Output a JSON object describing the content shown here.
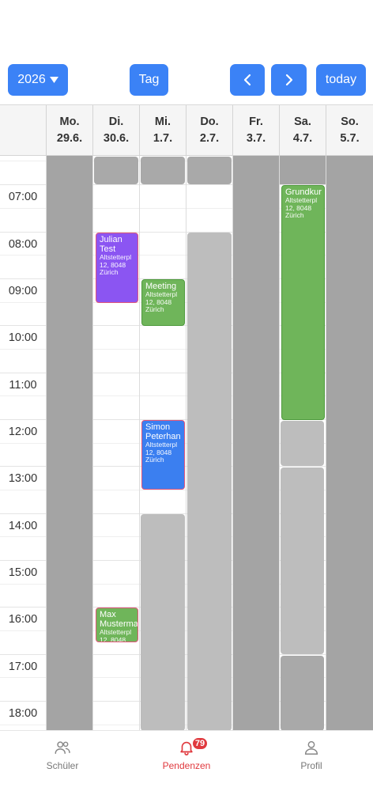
{
  "toolbar": {
    "year_label": "2026",
    "view_label": "Tag",
    "today_label": "today"
  },
  "calendar": {
    "days": [
      {
        "name": "Mo.",
        "date": "29.6."
      },
      {
        "name": "Di.",
        "date": "30.6."
      },
      {
        "name": "Mi.",
        "date": "1.7."
      },
      {
        "name": "Do.",
        "date": "2.7."
      },
      {
        "name": "Fr.",
        "date": "3.7."
      },
      {
        "name": "Sa.",
        "date": "4.7."
      },
      {
        "name": "So.",
        "date": "5.7."
      }
    ],
    "hours": [
      "07:00",
      "08:00",
      "09:00",
      "10:00",
      "11:00",
      "12:00",
      "13:00",
      "14:00",
      "15:00",
      "16:00",
      "17:00",
      "18:00"
    ],
    "events": [
      {
        "title": "Julian\nTest",
        "address": "Altstetterpl\n12, 8048\nZürich"
      },
      {
        "title": "Meeting",
        "address": "Altstetterpl\n12, 8048\nZürich"
      },
      {
        "title": "Simon\nPeterhan",
        "address": "Altstetterpl\n12, 8048\nZürich"
      },
      {
        "title": "Max\nMusterma",
        "address": "Altstetterpl\n12, 8048"
      },
      {
        "title": "Grundkur",
        "address": "Altstetterpl\n12, 8048\nZürich"
      }
    ]
  },
  "tabbar": {
    "tabs": [
      {
        "label": "Schüler"
      },
      {
        "label": "Pendenzen"
      },
      {
        "label": "Profil"
      }
    ],
    "badge_count": "79"
  },
  "colors": {
    "accent": "#3b82f6",
    "active_tab": "#e0393e",
    "event_purple": "#8b55f2",
    "event_green": "#6fb55a",
    "event_blue": "#3b7ff0"
  }
}
